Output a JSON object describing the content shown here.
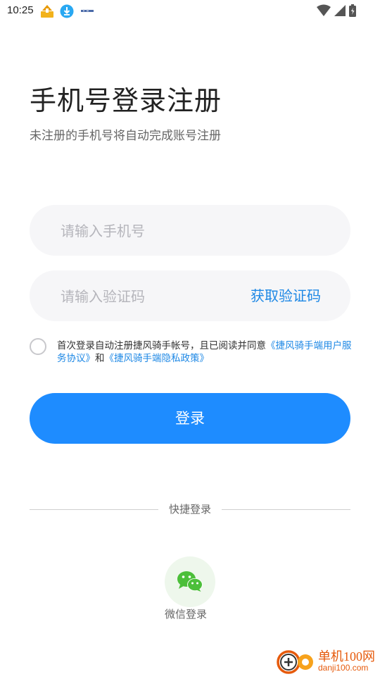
{
  "status_bar": {
    "time": "10:25",
    "left_icons": [
      "app-notification-icon",
      "download-icon",
      "small-logo-icon"
    ],
    "right_icons": [
      "wifi-icon",
      "signal-icon",
      "battery-charging-icon"
    ]
  },
  "header": {
    "title": "手机号登录注册",
    "subtitle": "未注册的手机号将自动完成账号注册"
  },
  "form": {
    "phone_placeholder": "请输入手机号",
    "code_placeholder": "请输入验证码",
    "get_code_label": "获取验证码"
  },
  "agreement": {
    "checked": false,
    "text_prefix": "首次登录自动注册捷风骑手帐号，且已阅读并同意",
    "user_agreement_link": "《捷风骑手端用户服务协议》",
    "conjunction": "和",
    "privacy_link": "《捷风骑手端隐私政策》"
  },
  "login_button_label": "登录",
  "quick_login": {
    "divider_label": "快捷登录",
    "wechat_label": "微信登录"
  },
  "watermark": {
    "line1": "单机100网",
    "line2": "danji100.com"
  },
  "colors": {
    "accent": "#1e8cff",
    "link": "#1e88e5",
    "wechat_green": "#4cbf3a",
    "field_bg": "#f6f6f8"
  }
}
